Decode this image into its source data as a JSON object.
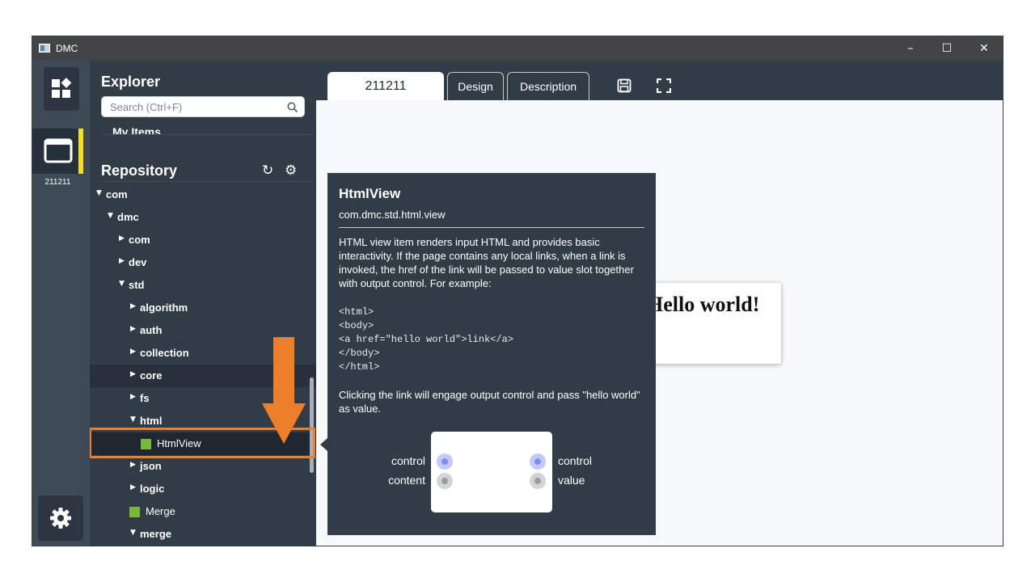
{
  "window": {
    "title": "DMC"
  },
  "rail": {
    "doc_label": "211211"
  },
  "explorer": {
    "title": "Explorer",
    "search_placeholder": "Search (Ctrl+F)",
    "my_items_label": "My Items",
    "repository_title": "Repository"
  },
  "tree": {
    "com": "com",
    "dmc": "dmc",
    "dmc_com": "com",
    "dev": "dev",
    "std": "std",
    "algorithm": "algorithm",
    "auth": "auth",
    "collection": "collection",
    "core": "core",
    "fs": "fs",
    "html": "html",
    "htmlview": "HtmlView",
    "json": "json",
    "logic": "logic",
    "merge_item": "Merge",
    "merge_folder": "merge"
  },
  "tabs": [
    {
      "label": "211211"
    },
    {
      "label": "Design"
    },
    {
      "label": "Description"
    }
  ],
  "canvas": {
    "card_text": "Hello world!"
  },
  "tooltip": {
    "title": "HtmlView",
    "subtitle": "com.dmc.std.html.view",
    "description": "HTML view item renders input HTML and provides basic interactivity. If the page contains any local links, when a link is invoked, the href of the link will be passed to value slot together with output control. For example:",
    "code": "<html>\n<body>\n<a href=\"hello world\">link</a>\n</body>\n</html>",
    "footer": "Clicking the link will engage output control and pass \"hello world\" as value.",
    "ports": {
      "in_control": "control",
      "in_content": "content",
      "out_control": "control",
      "out_value": "value"
    }
  },
  "colors": {
    "highlight": "#ed7f2b",
    "active_marker": "#f3e01a",
    "item_square": "#7ab935",
    "panel_bg": "#313c47"
  }
}
